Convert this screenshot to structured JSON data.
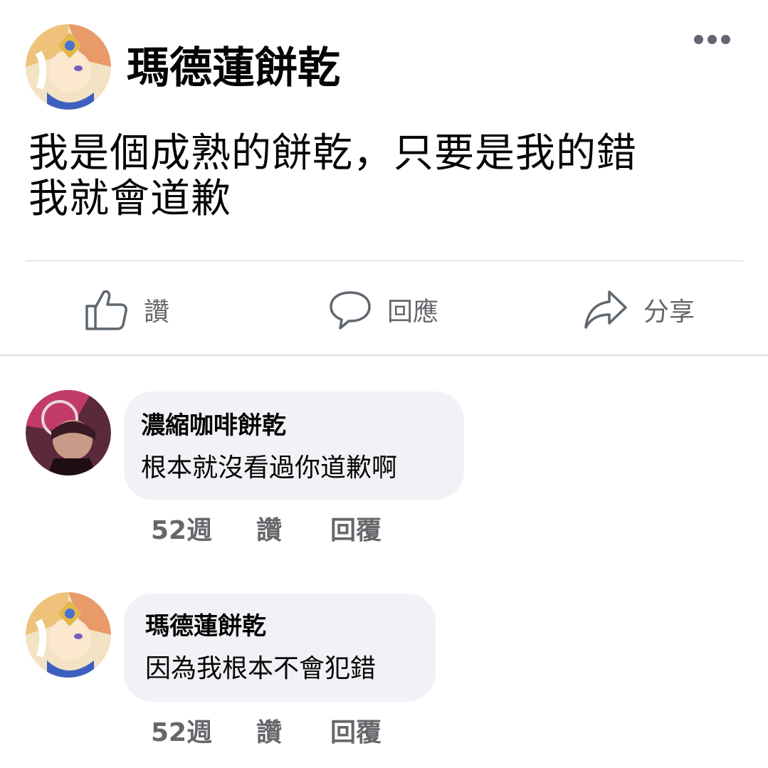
{
  "post": {
    "author": "瑪德蓮餅乾",
    "text_lines": [
      "我是個成熟的餅乾，只要是我的錯",
      "我就會道歉"
    ]
  },
  "actions": {
    "like": "讚",
    "comment": "回應",
    "share": "分享"
  },
  "comments": [
    {
      "author": "濃縮咖啡餅乾",
      "text": "根本就沒看過你道歉啊",
      "time": "52週",
      "like": "讚",
      "reply": "回覆"
    },
    {
      "author": "瑪德蓮餅乾",
      "text": "因為我根本不會犯錯",
      "time": "52週",
      "like": "讚",
      "reply": "回覆"
    }
  ],
  "icons": {
    "more": "more-horizontal-icon",
    "like": "thumbs-up-icon",
    "comment": "speech-bubble-icon",
    "share": "share-arrow-icon"
  },
  "colors": {
    "secondary_text": "#65676b",
    "bubble_bg": "#f0f2f5",
    "icon": "#606770"
  }
}
